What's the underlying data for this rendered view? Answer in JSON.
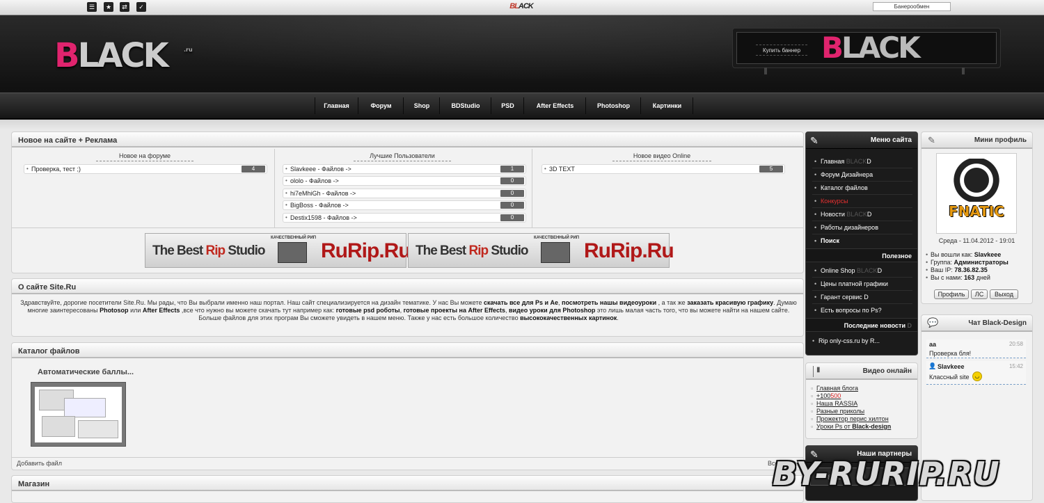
{
  "topbar": {
    "logo_a": "BL",
    "logo_b": "ACK",
    "banner_exchange": "Банерообмен",
    "icons": [
      "rss-icon",
      "star-icon",
      "share-icon",
      "check-icon"
    ]
  },
  "header": {
    "logo_pink": "B",
    "logo_rest": "LACK",
    "logo_suffix": ".ru",
    "buy_banner": "Купить баннер",
    "banner_pink": "B",
    "banner_rest": "LACK"
  },
  "nav": [
    "Главная",
    "Форум",
    "Shop",
    "BDStudio",
    "PSD",
    "After Effects",
    "Photoshop",
    "Картинки"
  ],
  "news_panel": {
    "title": "Новое на сайте + Реклама",
    "forum_head": "Новое на форуме",
    "users_head": "Лучшие Пользователи",
    "video_head": "Новое видео Online",
    "forum": [
      {
        "text": "Проверка, тест ;)",
        "count": "4"
      }
    ],
    "users": [
      {
        "text": "Slavkeee - Файлов ->",
        "count": "1"
      },
      {
        "text": "ololo - Файлов ->",
        "count": "0"
      },
      {
        "text": "hi7eMhiGh - Файлов ->",
        "count": "0"
      },
      {
        "text": "BigBoss - Файлов ->",
        "count": "0"
      },
      {
        "text": "Destix1598 - Файлов ->",
        "count": "0"
      }
    ],
    "videos": [
      {
        "text": "3D TEXT",
        "count": "5"
      }
    ]
  },
  "ads": {
    "t1_a": "The Best ",
    "t1_b": "Rip",
    "t1_c": " Studio",
    "small": "КАЧЕСТВЕННЫЙ РИП",
    "t2": "RuRip.Ru"
  },
  "about": {
    "title": "О сайте Site.Ru",
    "p1": "Здравствуйте, дорогие посетители Site.Ru. Мы рады, что Вы выбрали именно наш портал. Наш сайт специализируется на дизайн тематике. У нас Вы можете ",
    "b1": "скачать все для  Ps и Ae",
    "p2": ", ",
    "b2": "посмотреть нашы видеоуроки",
    "p3": " , а так же ",
    "b3": "заказать красивую графику",
    "p4": ". Думаю многие заинтересованы ",
    "b4": "Photosop",
    "p5": " или ",
    "b5": "After Effects",
    "p6": " ,все что нужно вы можете скачать тут например как: ",
    "b6": "готовые psd роботы",
    "p7": ", ",
    "b7": "готовые проекты на After Effects",
    "p8": ", ",
    "b8": "видео уроки для Photoshop",
    "p9": " это лишь малая часть того, что вы можете найти на нашем сайте. Больше файлов для этих програм Вы сможете увидеть в нашем меню. Также у нас есть большое количество ",
    "b9": "высококачественных картинок",
    "p10": "."
  },
  "catalog": {
    "title": "Каталог файлов",
    "item_title": "Автоматические баллы...",
    "add_file": "Добавить файл",
    "all": "Все"
  },
  "shop": {
    "title": "Магазин"
  },
  "site_menu": {
    "title": "Меню сайта",
    "items": [
      {
        "label": "Главная ",
        "suffix": "BLACK",
        "end": "D",
        "style": ""
      },
      {
        "label": "Форум Дизайнера",
        "suffix": "",
        "end": "",
        "style": ""
      },
      {
        "label": "Каталог файлов",
        "suffix": "",
        "end": "",
        "style": ""
      },
      {
        "label": "Конкурсы",
        "suffix": "",
        "end": "",
        "style": "red"
      },
      {
        "label": "Новости ",
        "suffix": "BLACK",
        "end": "D",
        "style": ""
      },
      {
        "label": "Работы дизайнеров",
        "suffix": "",
        "end": "",
        "style": ""
      },
      {
        "label": "Поиск",
        "suffix": "",
        "end": "",
        "style": "bold"
      }
    ],
    "useful_title": "Полезное",
    "useful": [
      {
        "label": "Online Shop ",
        "suffix": "BLACK",
        "end": "D"
      },
      {
        "label": "Цены платной графики",
        "suffix": "",
        "end": ""
      },
      {
        "label": "Гарант сервис ",
        "suffix": "",
        "end": "D"
      },
      {
        "label": "Есть вопросы по Ps?",
        "suffix": "",
        "end": ""
      }
    ],
    "news_title": "Последние новости ",
    "news_title_end": "D",
    "news": [
      {
        "label": "Rip only-css.ru by R..."
      }
    ]
  },
  "video_online": {
    "title": "Видео онлайн",
    "links": [
      {
        "a": "Главная блога",
        "b": "",
        "c": ""
      },
      {
        "a": "+100",
        "b": "500",
        "c": ""
      },
      {
        "a": "Наша RASSIA",
        "b": "",
        "c": ""
      },
      {
        "a": "Разные приколы",
        "b": "",
        "c": ""
      },
      {
        "a": "Прожектор перис хилтон",
        "b": "",
        "c": ""
      },
      {
        "a": "Уроки Ps от ",
        "b": "",
        "c": "Black-design"
      }
    ]
  },
  "partners": {
    "title": "Наши партнеры",
    "slot1": "88x3",
    "slot2": "88x3"
  },
  "mini_profile": {
    "title": "Мини профиль",
    "avatar_text": "FNATIC",
    "date": "Среда - 11.04.2012 - 19:01",
    "lines": [
      {
        "k": "Вы вошли как: ",
        "v": "Slavkeee"
      },
      {
        "k": "Группа: ",
        "v": "Администраторы"
      },
      {
        "k": "Ваш IP: ",
        "v": "78.36.82.35"
      },
      {
        "k": "Вы с нами: ",
        "v": "163",
        "e": " дней"
      }
    ],
    "btn_profile": "Профиль",
    "btn_pm": "ЛС",
    "btn_exit": "Выход"
  },
  "chat": {
    "title": "Чат Black-Design",
    "messages": [
      {
        "user": "aa",
        "time": "20:58",
        "text": "Проверка бля!"
      },
      {
        "user": "Slavkeee",
        "time": "15:42",
        "text": "Классный site"
      }
    ]
  },
  "watermark": "BY-RURIP.RU"
}
